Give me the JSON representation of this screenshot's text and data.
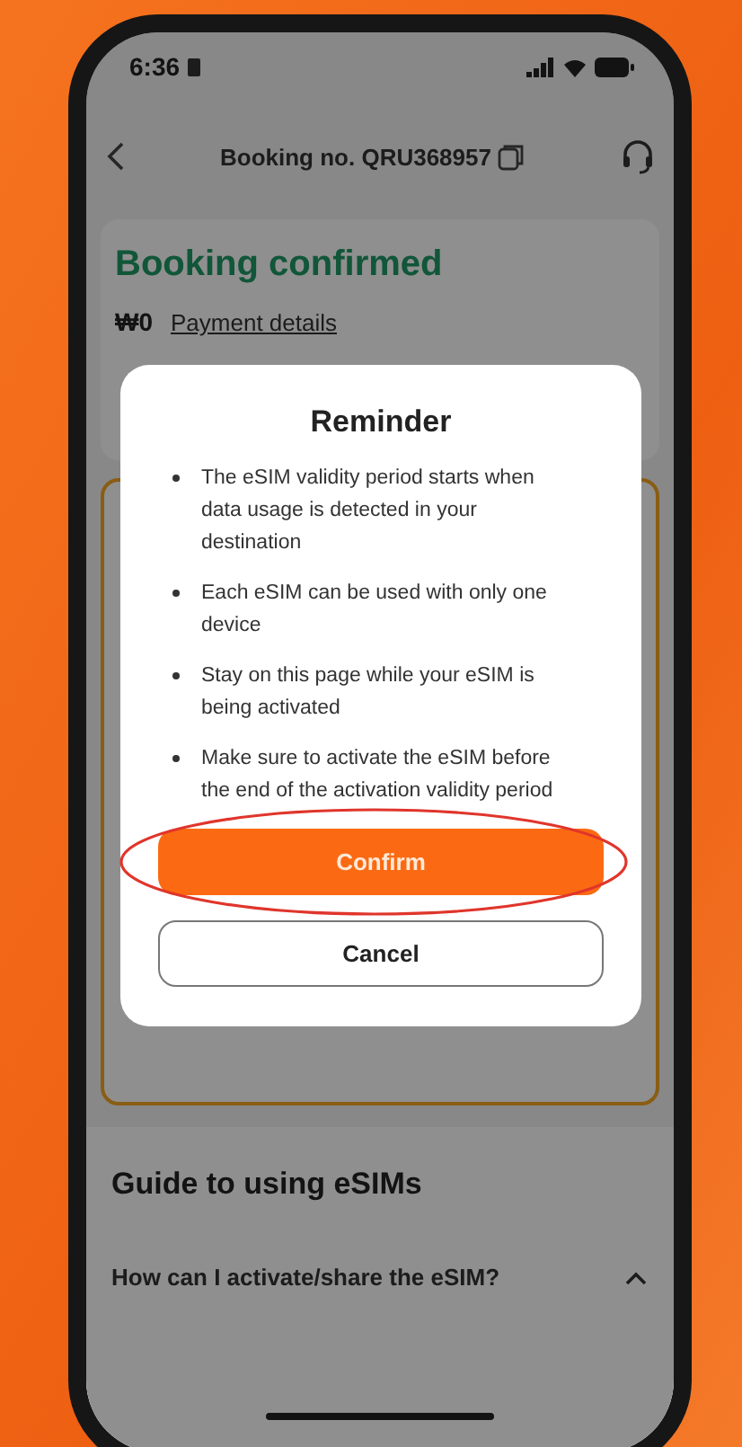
{
  "status_bar": {
    "time": "6:36"
  },
  "header": {
    "title": "Booking no. QRU368957"
  },
  "booking": {
    "status": "Booking confirmed",
    "amount": "₩0",
    "payment_link": "Payment details"
  },
  "dialog": {
    "title": "Reminder",
    "items": [
      "The eSIM validity period starts when data usage is detected in your destination",
      "Each eSIM can be used with only one device",
      "Stay on this page while your eSIM is being activated",
      "Make sure to activate the eSIM before the end of the activation validity period"
    ],
    "buttons": [
      {
        "label": "Confirm",
        "kind": "primary",
        "highlighted": true
      },
      {
        "label": "Cancel",
        "kind": "secondary",
        "highlighted": false
      }
    ]
  },
  "guide": {
    "title": "Guide to using eSIMs",
    "faq": [
      {
        "question": "How can I activate/share the eSIM?",
        "expanded": true
      }
    ]
  }
}
